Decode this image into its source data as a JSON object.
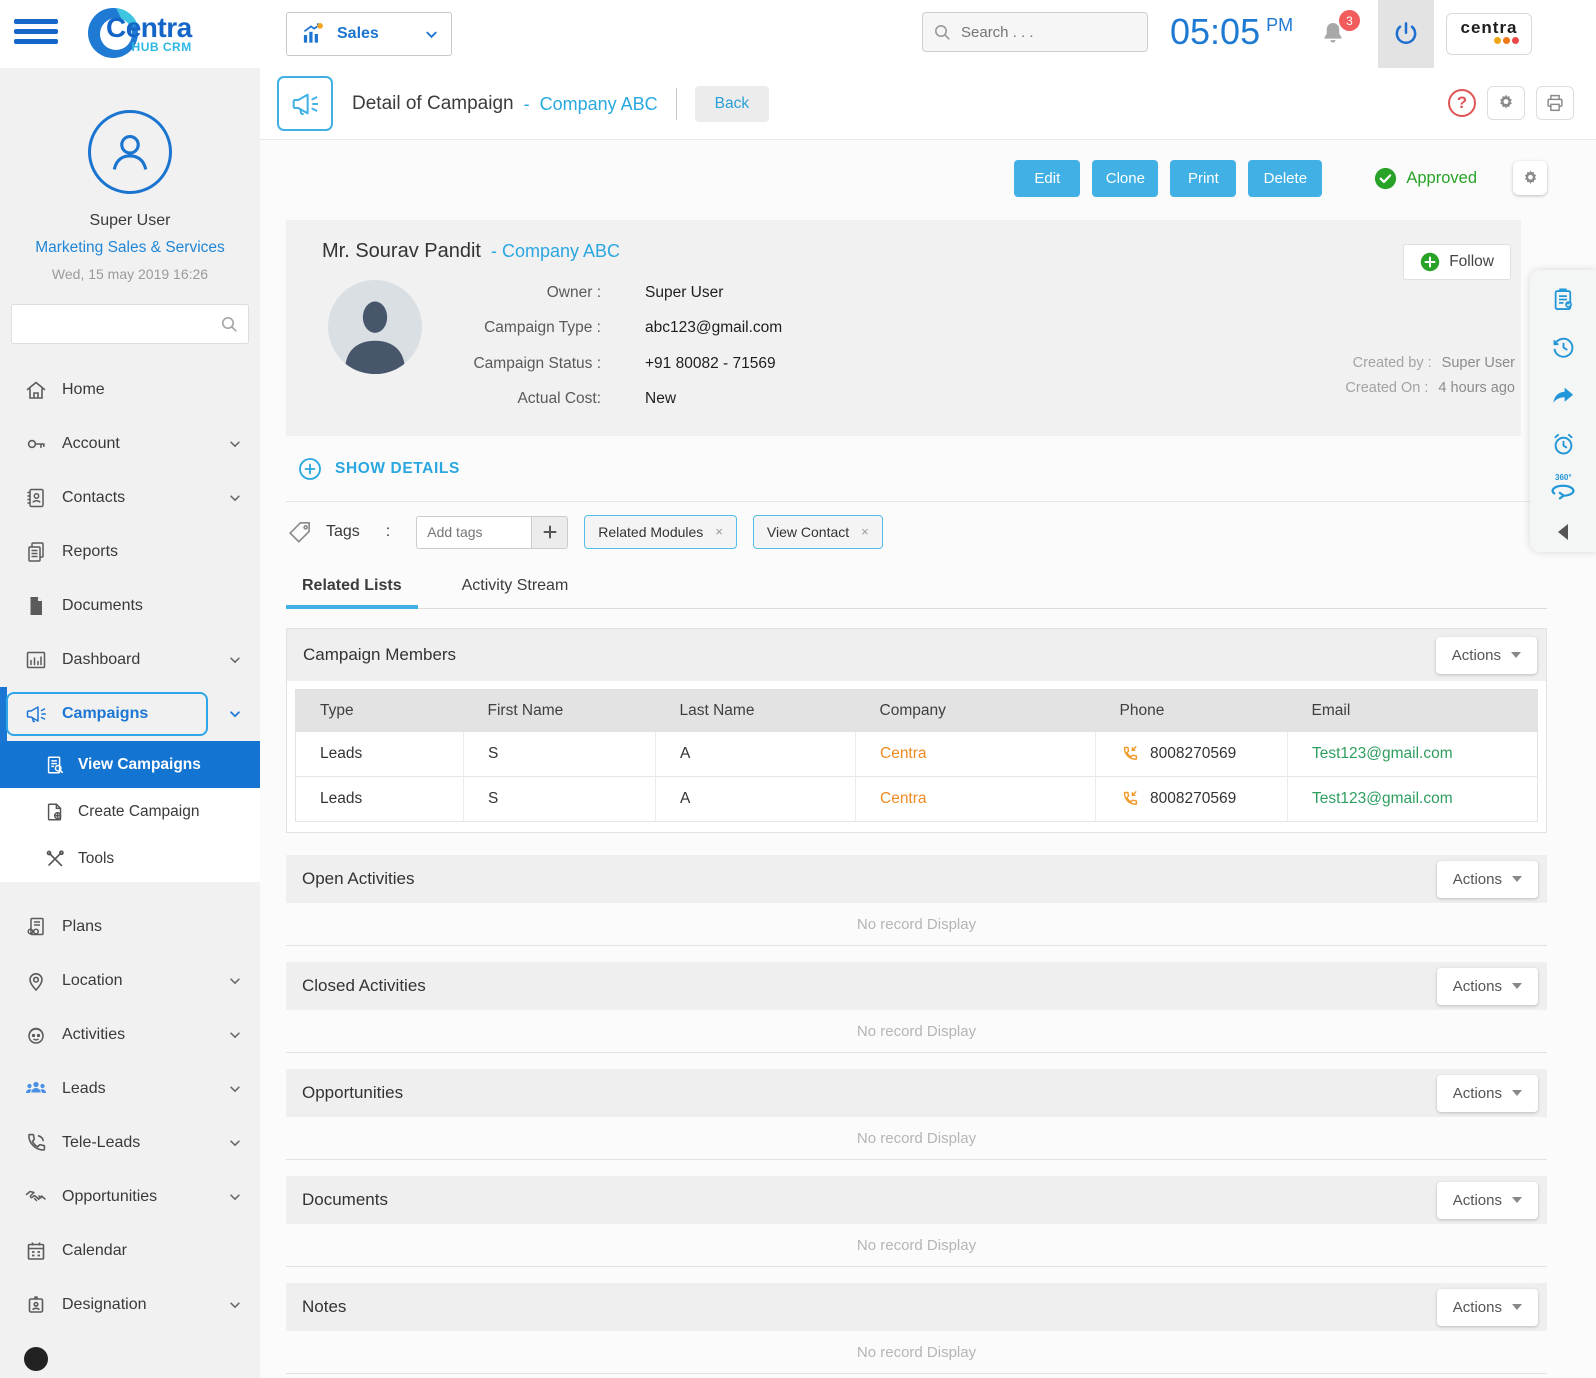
{
  "topbar": {
    "module": "Sales",
    "search_placeholder": "Search . . .",
    "time": "05:05",
    "meridiem": "PM",
    "notifications": "3",
    "brand": "centra"
  },
  "logo": {
    "name": "Centra",
    "sub": "HUB CRM"
  },
  "glyphs": {
    "help": "?",
    "close": "×",
    "colon": ":",
    "dash": "-",
    "deg360": "360°"
  },
  "sidebar": {
    "user": {
      "name": "Super User",
      "department": "Marketing Sales & Services",
      "datetime": "Wed, 15 may 2019 16:26"
    },
    "items": [
      "Home",
      "Account",
      "Contacts",
      "Reports",
      "Documents",
      "Dashboard",
      "Campaigns",
      "Plans",
      "Location",
      "Activities",
      "Leads",
      "Tele-Leads",
      "Opportunities",
      "Calendar",
      "Designation"
    ],
    "campaigns_submenu": [
      "View Campaigns",
      "Create Campaign",
      "Tools"
    ]
  },
  "header": {
    "title": "Detail of Campaign",
    "record_link": "Company ABC",
    "back": "Back"
  },
  "toolbar": {
    "edit": "Edit",
    "clone": "Clone",
    "print": "Print",
    "delete": "Delete",
    "status": "Approved"
  },
  "record": {
    "name": "Mr. Sourav Pandit",
    "company_link": "- Company ABC",
    "follow": "Follow",
    "fields": [
      {
        "label": "Owner :",
        "value": "Super User"
      },
      {
        "label": "Campaign Type :",
        "value": "abc123@gmail.com"
      },
      {
        "label": "Campaign Status :",
        "value": "+91 80082 - 71569"
      },
      {
        "label": "Actual Cost:",
        "value": "New"
      }
    ],
    "created_by_label": "Created by :",
    "created_by": "Super User",
    "created_on_label": "Created On :",
    "created_on": "4 hours ago",
    "show_details": "SHOW DETAILS"
  },
  "tags": {
    "label": "Tags",
    "placeholder": "Add tags",
    "chips": [
      "Related Modules",
      "View Contact"
    ]
  },
  "tabs": [
    "Related Lists",
    "Activity Stream"
  ],
  "members": {
    "title": "Campaign Members",
    "columns": [
      "Type",
      "First Name",
      "Last Name",
      "Company",
      "Phone",
      "Email"
    ],
    "rows": [
      {
        "type": "Leads",
        "first_name": "S",
        "last_name": "A",
        "company": "Centra",
        "phone": "8008270569",
        "email": "Test123@gmail.com"
      },
      {
        "type": "Leads",
        "first_name": "S",
        "last_name": "A",
        "company": "Centra",
        "phone": "8008270569",
        "email": "Test123@gmail.com"
      }
    ]
  },
  "sections": [
    {
      "title": "Open Activities"
    },
    {
      "title": "Closed Activities"
    },
    {
      "title": "Opportunities"
    },
    {
      "title": "Documents"
    },
    {
      "title": "Notes"
    }
  ],
  "labels": {
    "actions": "Actions",
    "no_record": "No record Display"
  },
  "colors": {
    "primary_blue": "#1b75d0",
    "button_blue": "#41b0e4",
    "link_blue": "#2aa7e0",
    "approved_green": "#28a328",
    "company_orange": "#ef8b23",
    "email_green": "#2e9e5f",
    "badge_red": "#f25c5c"
  }
}
